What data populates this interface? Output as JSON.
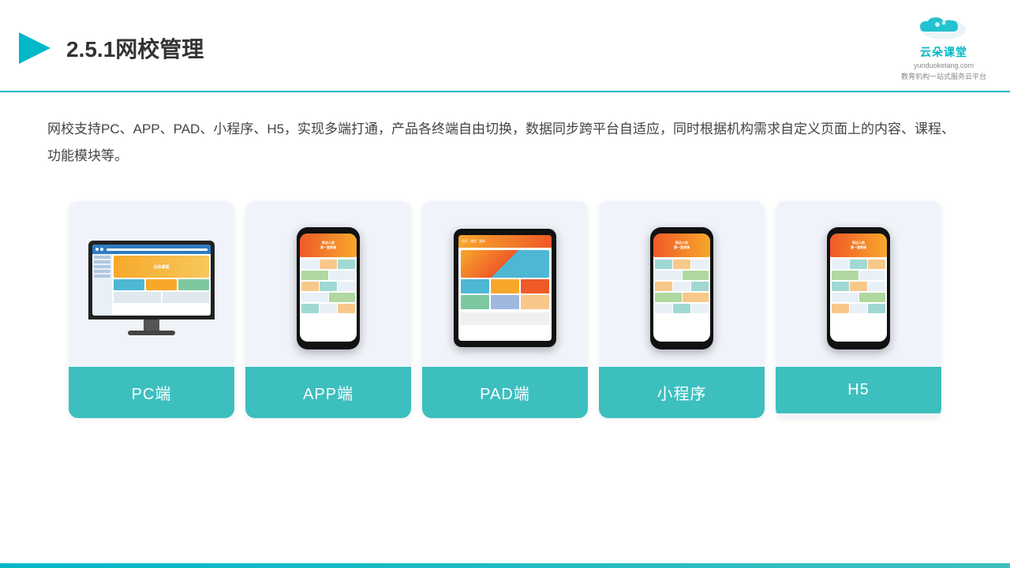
{
  "header": {
    "title": "2.5.1网校管理",
    "logo_brand": "云朵课堂",
    "logo_domain": "yunduoketang.com",
    "logo_tagline": "教育机构一站式服务云平台"
  },
  "description": "网校支持PC、APP、PAD、小程序、H5，实现多端打通，产品各终端自由切换，数据同步跨平台自适应，同时根据机构需求自定义页面上的内容、课程、功能模块等。",
  "cards": [
    {
      "label": "PC端",
      "type": "pc"
    },
    {
      "label": "APP端",
      "type": "phone"
    },
    {
      "label": "PAD端",
      "type": "tablet"
    },
    {
      "label": "小程序",
      "type": "phone2"
    },
    {
      "label": "H5",
      "type": "phone3"
    }
  ]
}
